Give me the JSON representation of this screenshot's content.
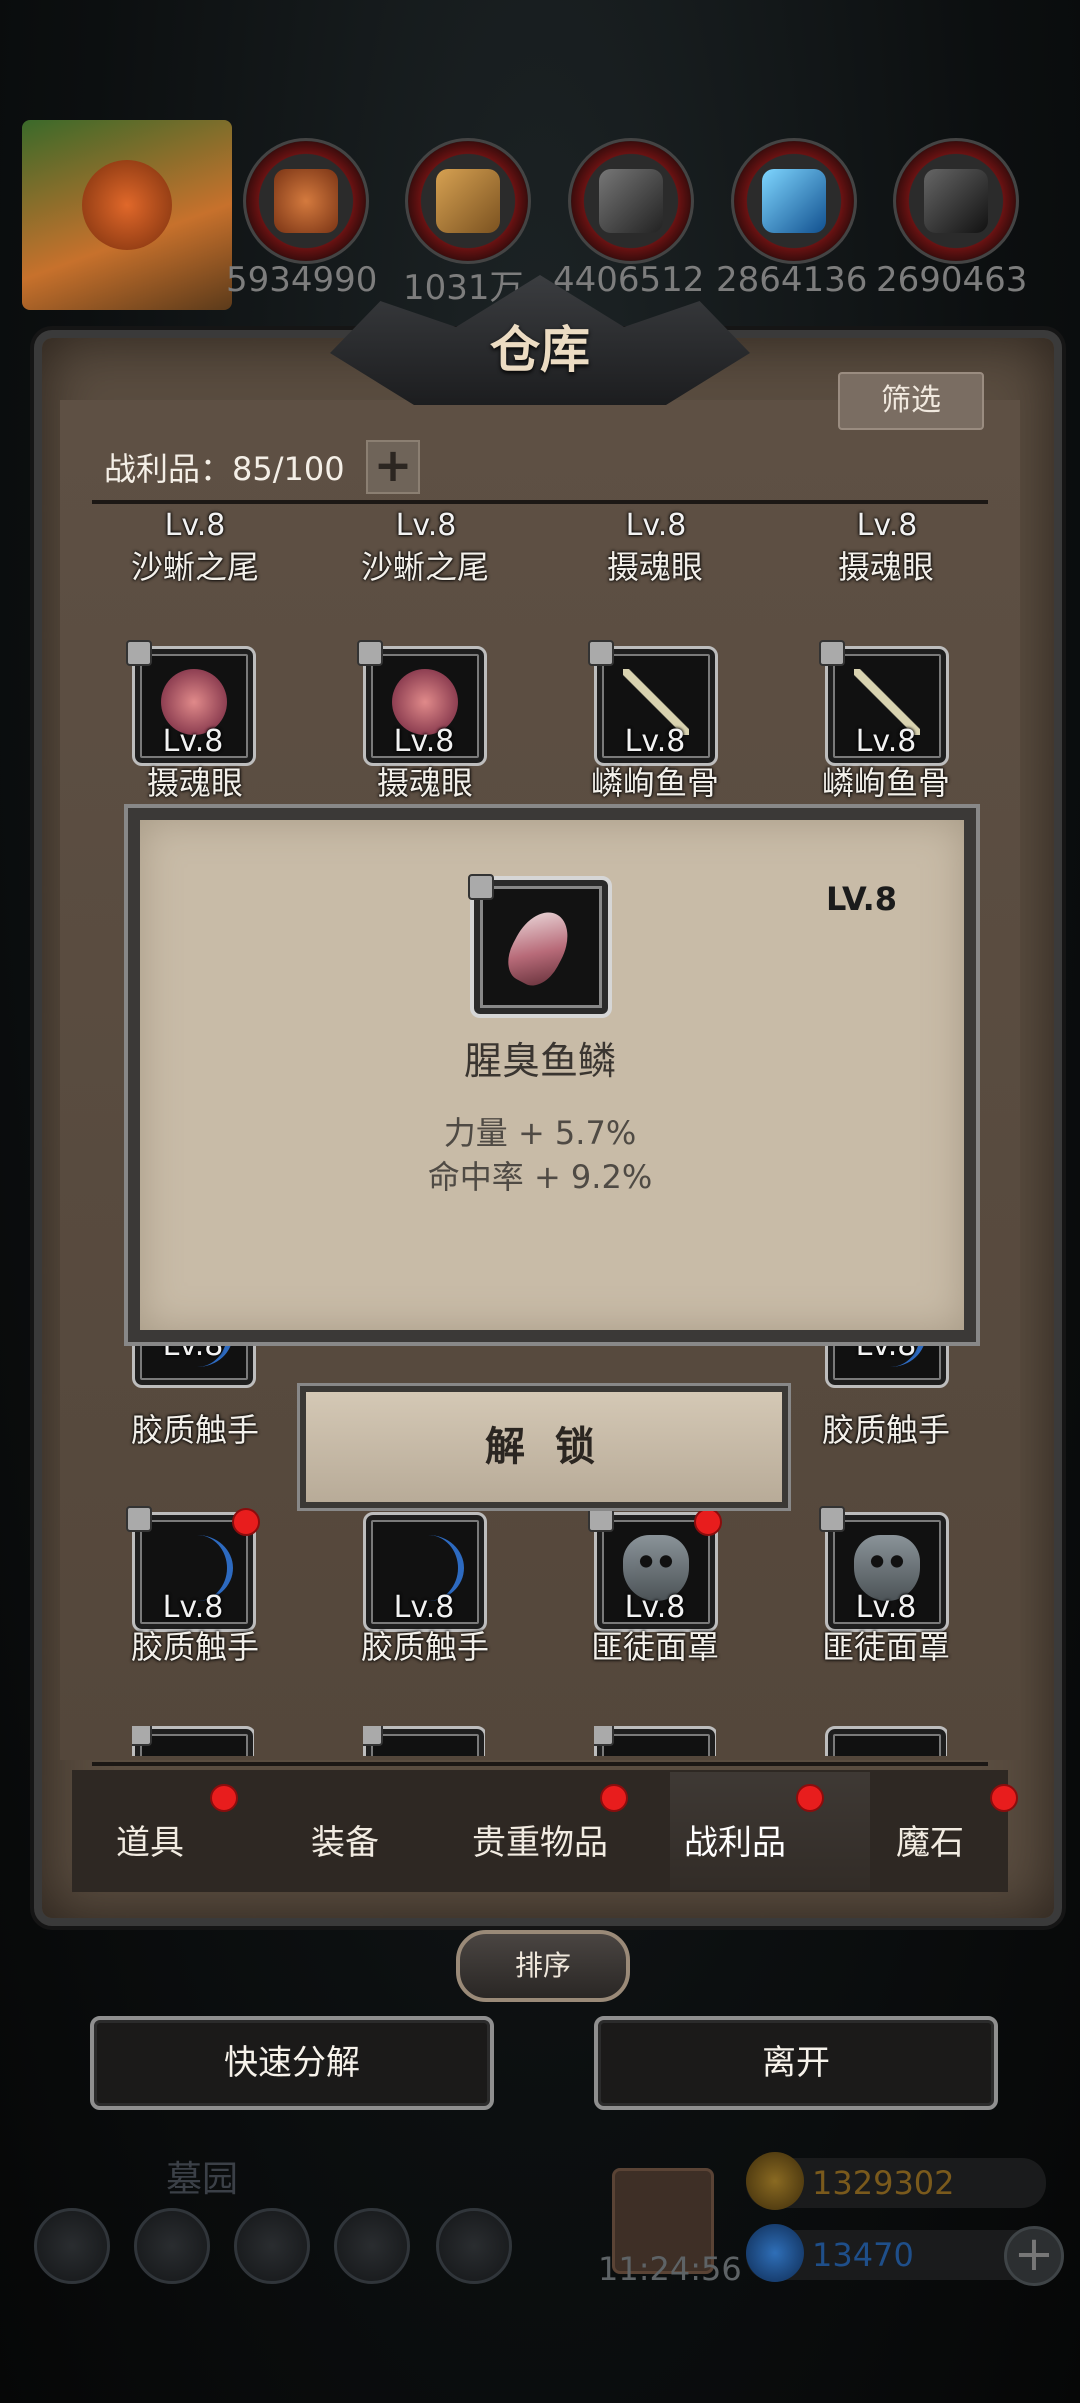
{
  "resources": [
    {
      "icon": "meat-icon",
      "value": "5934990",
      "color": "#a9532a"
    },
    {
      "icon": "wood-icon",
      "value": "1031万",
      "color": "#b8873c"
    },
    {
      "icon": "stone-icon",
      "value": "4406512",
      "color": "#555555"
    },
    {
      "icon": "crystal-icon",
      "value": "2864136",
      "color": "#2f8fd0"
    },
    {
      "icon": "iron-icon",
      "value": "2690463",
      "color": "#3c3c3c"
    }
  ],
  "warehouse": {
    "title": "仓库",
    "filter_label": "筛选",
    "loot_label": "战利品：85/100",
    "plus_label": "+"
  },
  "grid": {
    "row1": [
      "沙蜥之尾",
      "沙蜥之尾",
      "摄魂眼",
      "摄魂眼"
    ],
    "row2": [
      "摄魂眼",
      "摄魂眼",
      "嶙峋鱼骨",
      "嶙峋鱼骨"
    ],
    "row_tentacle": [
      "胶质触手",
      "胶质触手"
    ],
    "row4": [
      "胶质触手",
      "胶质触手",
      "匪徒面罩",
      "匪徒面罩"
    ],
    "level": "Lv.8"
  },
  "popup": {
    "level": "LV.8",
    "name": "腥臭鱼鳞",
    "stat1": "力量 + 5.7%",
    "stat2": "命中率 + 9.2%",
    "unlock_label": "解 锁"
  },
  "tabs": [
    {
      "label": "道具",
      "dot": true
    },
    {
      "label": "装备",
      "dot": false
    },
    {
      "label": "贵重物品",
      "dot": true
    },
    {
      "label": "战利品",
      "dot": true
    },
    {
      "label": "魔石",
      "dot": true
    }
  ],
  "sort_label": "排序",
  "buttons": {
    "quick_decompose": "快速分解",
    "leave": "离开"
  },
  "hud": {
    "location": "墓园",
    "timer": "11:24:56",
    "gold": "1329302",
    "gems": "13470",
    "gold_color": "#7a5a1c",
    "gem_color": "#1f4f8a"
  }
}
